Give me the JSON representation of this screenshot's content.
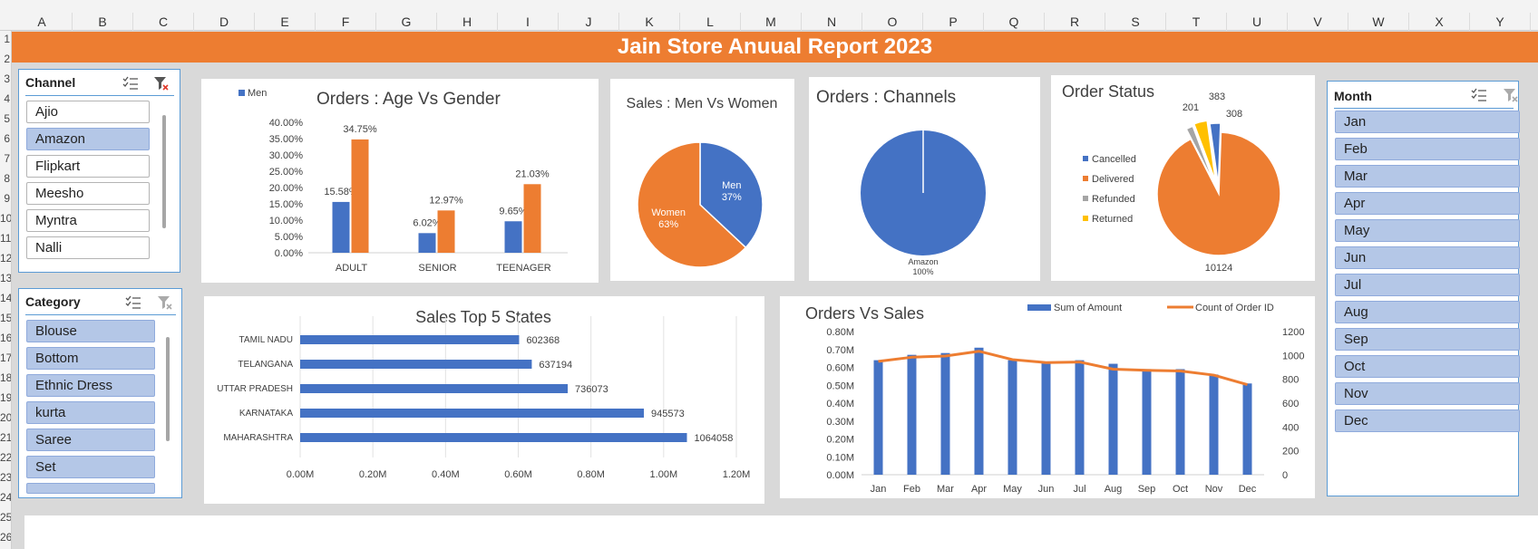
{
  "columns": [
    "A",
    "B",
    "C",
    "D",
    "E",
    "F",
    "G",
    "H",
    "I",
    "J",
    "K",
    "L",
    "M",
    "N",
    "O",
    "P",
    "Q",
    "R",
    "S",
    "T",
    "U",
    "V",
    "W",
    "X",
    "Y"
  ],
  "rows": [
    "1",
    "2",
    "3",
    "4",
    "5",
    "6",
    "7",
    "8",
    "9",
    "10",
    "11",
    "12",
    "13",
    "14",
    "15",
    "16",
    "17",
    "18",
    "19",
    "20",
    "21",
    "22",
    "23",
    "24",
    "25",
    "26"
  ],
  "banner": {
    "title": "Jain Store Anuual Report 2023"
  },
  "channel_slicer": {
    "title": "Channel",
    "items": [
      {
        "label": "Ajio",
        "selected": false
      },
      {
        "label": "Amazon",
        "selected": true
      },
      {
        "label": "Flipkart",
        "selected": false
      },
      {
        "label": "Meesho",
        "selected": false
      },
      {
        "label": "Myntra",
        "selected": false
      },
      {
        "label": "Nalli",
        "selected": false
      }
    ]
  },
  "category_slicer": {
    "title": "Category",
    "items": [
      {
        "label": "Blouse",
        "selected": true
      },
      {
        "label": "Bottom",
        "selected": true
      },
      {
        "label": "Ethnic Dress",
        "selected": true
      },
      {
        "label": "kurta",
        "selected": true
      },
      {
        "label": "Saree",
        "selected": true
      },
      {
        "label": "Set",
        "selected": true
      }
    ]
  },
  "month_slicer": {
    "title": "Month",
    "items": [
      "Jan",
      "Feb",
      "Mar",
      "Apr",
      "May",
      "Jun",
      "Jul",
      "Aug",
      "Sep",
      "Oct",
      "Nov",
      "Dec"
    ]
  },
  "colors": {
    "blue": "#4472c4",
    "orange": "#ed7d31",
    "gray": "#a5a5a5",
    "yellow": "#ffc000",
    "accent": "#ed7d31"
  },
  "chart_data": [
    {
      "id": "age_gender",
      "type": "bar",
      "title": "Orders : Age Vs Gender",
      "legend": [
        "Men"
      ],
      "categories": [
        "ADULT",
        "SENIOR",
        "TEENAGER"
      ],
      "series": [
        {
          "name": "Men",
          "values": [
            15.58,
            6.02,
            9.65
          ],
          "labels": [
            "15.58%",
            "6.02%",
            "9.65%"
          ]
        },
        {
          "values": [
            34.75,
            12.97,
            21.03
          ],
          "labels": [
            "34.75%",
            "12.97%",
            "21.03%"
          ]
        }
      ],
      "ylim": [
        0,
        40
      ],
      "yticks": [
        "0.00%",
        "5.00%",
        "10.00%",
        "15.00%",
        "20.00%",
        "25.00%",
        "30.00%",
        "35.00%",
        "40.00%"
      ]
    },
    {
      "id": "men_women",
      "type": "pie",
      "title": "Sales : Men Vs Women",
      "slices": [
        {
          "name": "Men",
          "value": 37,
          "label": "37%"
        },
        {
          "name": "Women",
          "value": 63,
          "label": "63%"
        }
      ]
    },
    {
      "id": "channels",
      "type": "pie",
      "title": "Orders : Channels",
      "slices": [
        {
          "name": "Amazon",
          "value": 100,
          "label": "100%"
        }
      ]
    },
    {
      "id": "order_status",
      "type": "pie",
      "title": "Order Status",
      "legend": [
        "Cancelled",
        "Delivered",
        "Refunded",
        "Returned"
      ],
      "slices": [
        {
          "name": "Cancelled",
          "value": 308,
          "label": "308"
        },
        {
          "name": "Delivered",
          "value": 10124,
          "label": "10124"
        },
        {
          "name": "Refunded",
          "value": 201,
          "label": "201"
        },
        {
          "name": "Returned",
          "value": 383,
          "label": "383"
        }
      ]
    },
    {
      "id": "top_states",
      "type": "bar",
      "orientation": "horizontal",
      "title": "Sales Top 5 States",
      "categories": [
        "TAMIL NADU",
        "TELANGANA",
        "UTTAR PRADESH",
        "KARNATAKA",
        "MAHARASHTRA"
      ],
      "values": [
        602368,
        637194,
        736073,
        945573,
        1064058
      ],
      "labels": [
        "602368",
        "637194",
        "736073",
        "945573",
        "1064058"
      ],
      "xlim": [
        0,
        1200000
      ],
      "xticks": [
        "0.00M",
        "0.20M",
        "0.40M",
        "0.60M",
        "0.80M",
        "1.00M",
        "1.20M"
      ]
    },
    {
      "id": "orders_sales",
      "type": "bar",
      "title": "Orders Vs Sales",
      "categories": [
        "Jan",
        "Feb",
        "Mar",
        "Apr",
        "May",
        "Jun",
        "Jul",
        "Aug",
        "Sep",
        "Oct",
        "Nov",
        "Dec"
      ],
      "series": [
        {
          "name": "Sum of Amount",
          "type": "bar",
          "values": [
            0.64,
            0.67,
            0.68,
            0.71,
            0.64,
            0.63,
            0.64,
            0.62,
            0.59,
            0.59,
            0.56,
            0.51
          ]
        },
        {
          "name": "Count of Order ID",
          "type": "line",
          "values": [
            950,
            985,
            995,
            1035,
            965,
            940,
            945,
            885,
            875,
            870,
            835,
            755
          ]
        }
      ],
      "ylim": [
        0,
        0.8
      ],
      "yticks": [
        "0.00M",
        "0.10M",
        "0.20M",
        "0.30M",
        "0.40M",
        "0.50M",
        "0.60M",
        "0.70M",
        "0.80M"
      ],
      "y2lim": [
        0,
        1200
      ],
      "y2ticks": [
        "0",
        "200",
        "400",
        "600",
        "800",
        "1000",
        "1200"
      ]
    }
  ]
}
